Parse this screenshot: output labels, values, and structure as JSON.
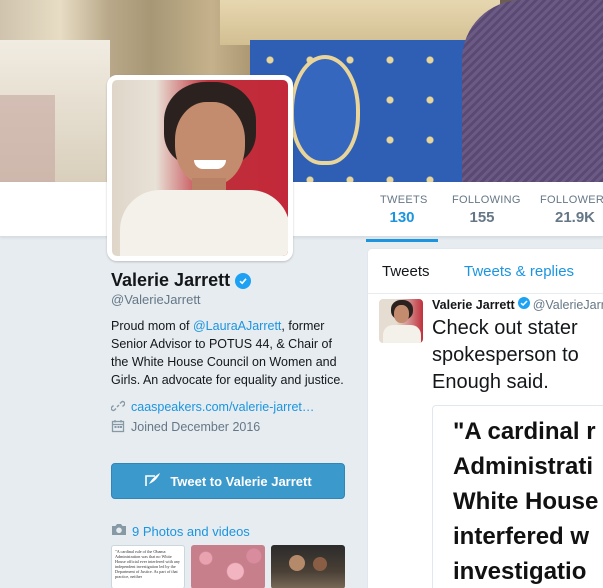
{
  "nav": {
    "tweets_label": "TWEETS",
    "tweets_value": "130",
    "following_label": "FOLLOWING",
    "following_value": "155",
    "followers_label": "FOLLOWERS",
    "followers_value": "21.9K"
  },
  "profile": {
    "name": "Valerie Jarrett",
    "handle": "@ValerieJarrett",
    "bio_pre": "Proud mom of ",
    "bio_link": "@LauraAJarrett",
    "bio_post": ", former Senior Advisor to POTUS 44, & Chair of the White House Council on Women and Girls. An advocate for equality and justice.",
    "website": "caaspeakers.com/valerie-jarret…",
    "joined": "Joined December 2016",
    "tweet_button": "Tweet to Valerie Jarrett",
    "photos_link": "9 Photos and videos",
    "thumb1_text": "\"A cardinal rule of the Obama Administration was that no White House official ever interfered with any independent investigation led by the Department of Justice. As part of that practice, neither"
  },
  "timeline": {
    "tab_tweets": "Tweets",
    "tab_replies": "Tweets & replies",
    "tweet": {
      "name": "Valerie Jarrett",
      "handle": "@ValerieJarr",
      "text_lines": [
        "Check out stater",
        "spokesperson to",
        "Enough said."
      ],
      "card_lines": [
        "\"A cardinal r",
        "Administrati",
        "White House",
        "interfered w",
        "investigatio"
      ]
    }
  },
  "colors": {
    "accent": "#1b95e0",
    "button": "#3b99cc",
    "verified": "#1da1f2"
  }
}
